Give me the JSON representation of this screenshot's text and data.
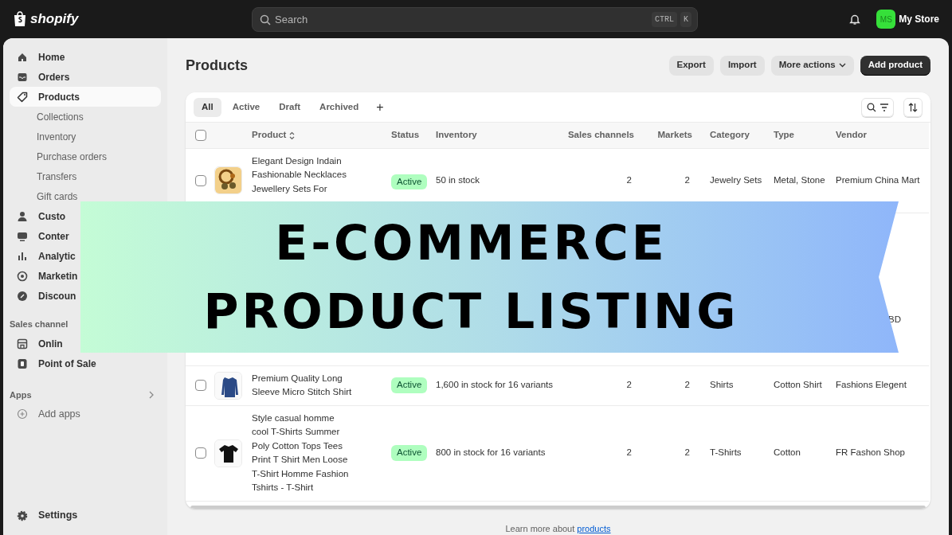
{
  "topbar": {
    "logo": "shopify",
    "search": {
      "placeholder": "Search",
      "keys": [
        "CTRL",
        "K"
      ]
    },
    "store": {
      "initials": "MS",
      "name": "My Store"
    }
  },
  "sidebar": {
    "items": [
      {
        "label": "Home",
        "kind": "main",
        "selected": false
      },
      {
        "label": "Orders",
        "kind": "main",
        "selected": false
      },
      {
        "label": "Products",
        "kind": "main",
        "selected": true
      },
      {
        "label": "Collections",
        "kind": "sub",
        "selected": false
      },
      {
        "label": "Inventory",
        "kind": "sub",
        "selected": false
      },
      {
        "label": "Purchase orders",
        "kind": "sub",
        "selected": false
      },
      {
        "label": "Transfers",
        "kind": "sub",
        "selected": false
      },
      {
        "label": "Gift cards",
        "kind": "sub",
        "selected": false
      },
      {
        "label": "Custo",
        "kind": "main",
        "selected": false
      },
      {
        "label": "Conter",
        "kind": "main",
        "selected": false
      },
      {
        "label": "Analytic",
        "kind": "main",
        "selected": false
      },
      {
        "label": "Marketin",
        "kind": "main",
        "selected": false
      },
      {
        "label": "Discoun",
        "kind": "main",
        "selected": false
      }
    ],
    "sales_heading": "Sales channel",
    "sales_items": [
      {
        "label": "Onlin"
      },
      {
        "label": "Point of Sale"
      }
    ],
    "apps_heading": "Apps",
    "add_apps": "Add apps",
    "settings": "Settings"
  },
  "page": {
    "title": "Products",
    "actions": [
      {
        "label": "Export",
        "kind": "secondary"
      },
      {
        "label": "Import",
        "kind": "secondary"
      },
      {
        "label": "More actions",
        "kind": "menu"
      },
      {
        "label": "Add product",
        "kind": "primary"
      }
    ]
  },
  "tabs": [
    {
      "label": "All",
      "selected": true
    },
    {
      "label": "Active",
      "selected": false
    },
    {
      "label": "Draft",
      "selected": false
    },
    {
      "label": "Archived",
      "selected": false
    }
  ],
  "add_tab": "+",
  "table": {
    "select_all_checked": false,
    "columns": [
      "Product",
      "Status",
      "Inventory",
      "Sales channels",
      "Markets",
      "Category",
      "Type",
      "Vendor"
    ],
    "rows": [
      {
        "kind": "product",
        "checked": false,
        "product": [
          "Elegant Design Indain",
          "Fashionable Necklaces",
          "Jewellery Sets For"
        ],
        "status": "Active",
        "inventory": "50 in stock",
        "sales_channels": "2",
        "markets": "2",
        "category": "Jewelry Sets",
        "type": "Metal, Stone",
        "vendor": "Premium China Mart"
      },
      {
        "kind": "covered",
        "vendor": "BD"
      },
      {
        "kind": "product",
        "checked": false,
        "product": [
          "Premium Quality Long",
          "Sleeve Micro Stitch Shirt"
        ],
        "status": "Active",
        "inventory": "1,600 in stock for 16 variants",
        "sales_channels": "2",
        "markets": "2",
        "category": "Shirts",
        "type": "Cotton Shirt",
        "vendor": "Fashions Elegent"
      },
      {
        "kind": "product",
        "checked": false,
        "product": [
          "Style casual homme",
          "cool T-Shirts Summer",
          "Poly Cotton Tops Tees",
          "Print T Shirt Men Loose",
          "T-Shirt Homme Fashion",
          "Tshirts - T-Shirt"
        ],
        "status": "Active",
        "inventory": "800 in stock for 16 variants",
        "sales_channels": "2",
        "markets": "2",
        "category": "T-Shirts",
        "type": "Cotton",
        "vendor": "FR Fashon Shop"
      }
    ]
  },
  "footer": {
    "text": "Learn more about",
    "link": "products"
  },
  "banner": {
    "lines": [
      "E-COMMERCE",
      "PRODUCT LISTING"
    ]
  }
}
